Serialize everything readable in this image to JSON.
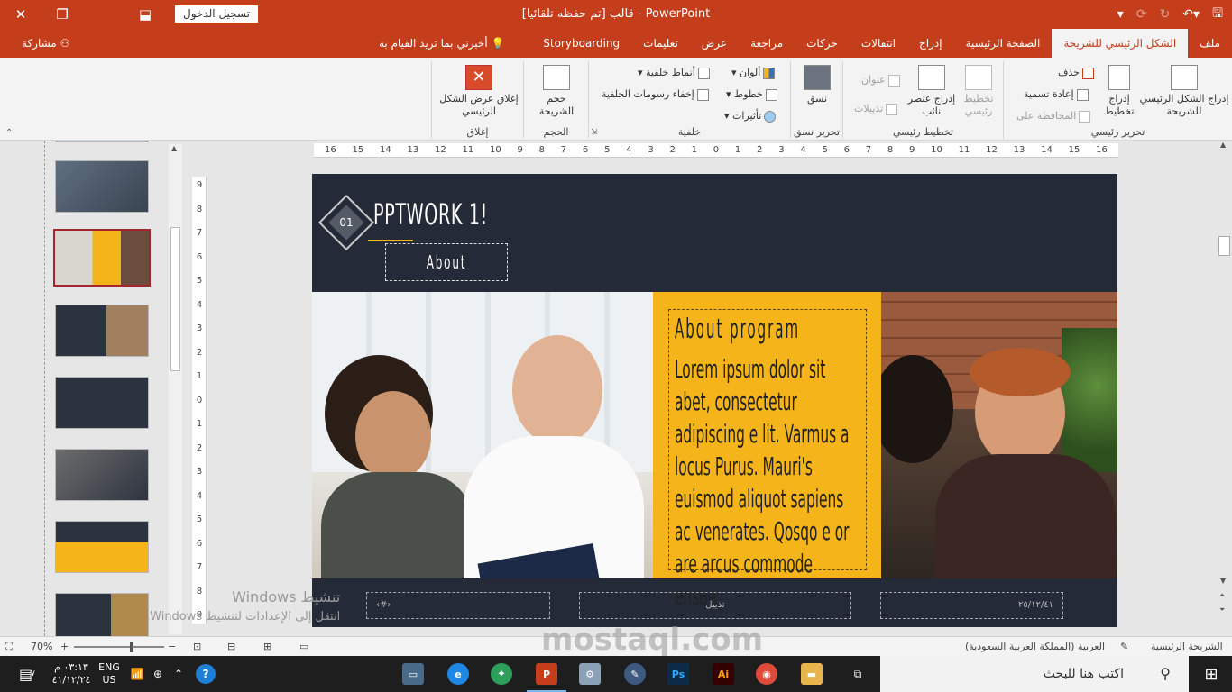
{
  "titlebar": {
    "doc_title": "قالب [تم حفظه تلقائيا]  -  PowerPoint",
    "signin": "تسجيل الدخول",
    "close_icon": "✕",
    "restore_icon": "❐",
    "ribbon_display_icon": "⬓"
  },
  "tabs": [
    {
      "label": "ملف"
    },
    {
      "label": "الشكل الرئيسي للشريحة",
      "active": true
    },
    {
      "label": "الصفحة الرئيسية"
    },
    {
      "label": "إدراج"
    },
    {
      "label": "انتقالات"
    },
    {
      "label": "حركات"
    },
    {
      "label": "مراجعة"
    },
    {
      "label": "عرض"
    },
    {
      "label": "تعليمات"
    },
    {
      "label": "Storyboarding"
    }
  ],
  "tellme": "أخبرني بما تريد القيام به",
  "share": "مشاركة",
  "ribbon": {
    "edit_master": {
      "label": "تحرير رئيسي",
      "insert_master": "إدراج الشكل الرئيسي للشريحة",
      "insert_layout": "إدراج تخطيط",
      "delete": "حذف",
      "rename": "إعادة تسمية",
      "preserve": "المحافظة على"
    },
    "master_layout": {
      "label": "تخطيط رئيسي",
      "master_layout_btn": "تخطيط رئيسي",
      "insert_placeholder": "إدراج عنصر نائب",
      "title": "عنوان",
      "footers": "تذييلات"
    },
    "edit_theme": {
      "label": "تحرير نسق",
      "themes": "نسق"
    },
    "background": {
      "label": "خلفية",
      "colors": "ألوان",
      "fonts": "خطوط",
      "effects": "تأثيرات",
      "bg_styles": "أنماط خلفية",
      "hide_bg": "إخفاء رسومات الخلفية"
    },
    "size": {
      "label": "الحجم",
      "slide_size": "حجم الشريحة"
    },
    "close": {
      "label": "إغلاق",
      "close_master": "إغلاق عرض الشكل الرئيسي"
    }
  },
  "rulers": {
    "horizontal": [
      "16",
      "15",
      "14",
      "13",
      "12",
      "11",
      "10",
      "9",
      "8",
      "7",
      "6",
      "5",
      "4",
      "3",
      "2",
      "1",
      "0",
      "1",
      "2",
      "3",
      "4",
      "5",
      "6",
      "7",
      "8",
      "9",
      "10",
      "11",
      "12",
      "13",
      "14",
      "15",
      "16"
    ],
    "vertical": [
      "9",
      "8",
      "7",
      "6",
      "5",
      "4",
      "3",
      "2",
      "1",
      "0",
      "1",
      "2",
      "3",
      "4",
      "5",
      "6",
      "7",
      "8",
      "9"
    ]
  },
  "slide": {
    "number": "01",
    "title": "PPTWORK 1!",
    "subtitle": "About program",
    "panel_heading": "About program",
    "panel_body": "Lorem ipsum dolor sit abet, consectetur adipiscing e lit. Varmus a locus Purus. Mauri's euismod aliquot sapiens ac venerates. Qosqo e or are arcus commode ensue",
    "footer_left": "‹#›",
    "footer_mid": "تذييل",
    "footer_right": "٢٥/١٢/٤١",
    "colors": {
      "background": "#242a37",
      "accent": "#f4b41a"
    }
  },
  "statusbar": {
    "view": "الشريحة الرئيسية",
    "language": "العربية (المملكة العربية السعودية)",
    "zoom": "70%",
    "zoom_minus": "−",
    "zoom_plus": "+"
  },
  "watermark": {
    "line1": "تنشيط Windows",
    "line2": "انتقل إلى الإعدادات لتنشيط Windows.",
    "brand": "mostaql.com"
  },
  "taskbar": {
    "search_placeholder": "اكتب هنا للبحث",
    "lang_top": "ENG",
    "lang_bottom": "US",
    "time": "٠٣:١٣ م",
    "date": "٤١/١٢/٢٤",
    "notif_badge": "٧"
  }
}
